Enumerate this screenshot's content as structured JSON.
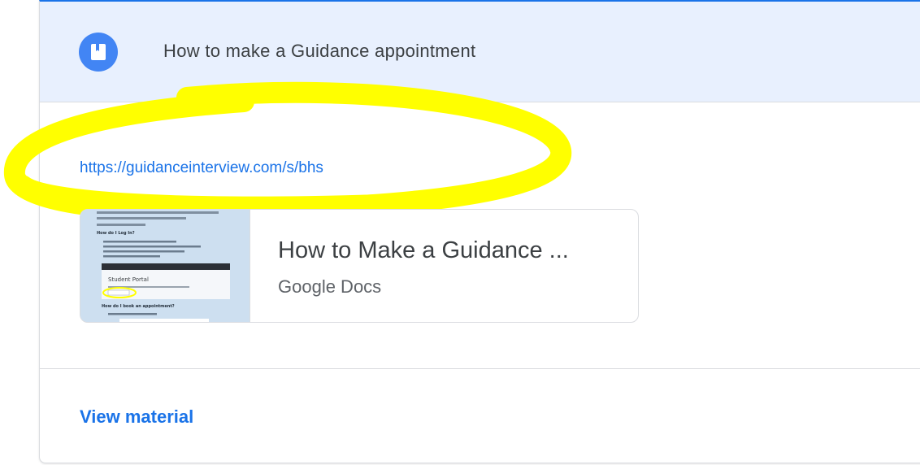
{
  "header": {
    "title": "How to make a Guidance appointment",
    "icon": "book-icon"
  },
  "link": {
    "url": "https://guidanceinterview.com/s/bhs"
  },
  "attachment": {
    "title": "How to Make a Guidance ...",
    "source": "Google Docs",
    "thumbnail": {
      "heading_login": "How do I Log In?",
      "portal_label": "Student Portal",
      "heading_book": "How do I book an appointment?"
    }
  },
  "footer": {
    "action_label": "View material"
  },
  "colors": {
    "accent": "#1a73e8",
    "header_bg": "#e8f0fe",
    "icon_bg": "#4285f4",
    "highlight": "#ffff00"
  }
}
